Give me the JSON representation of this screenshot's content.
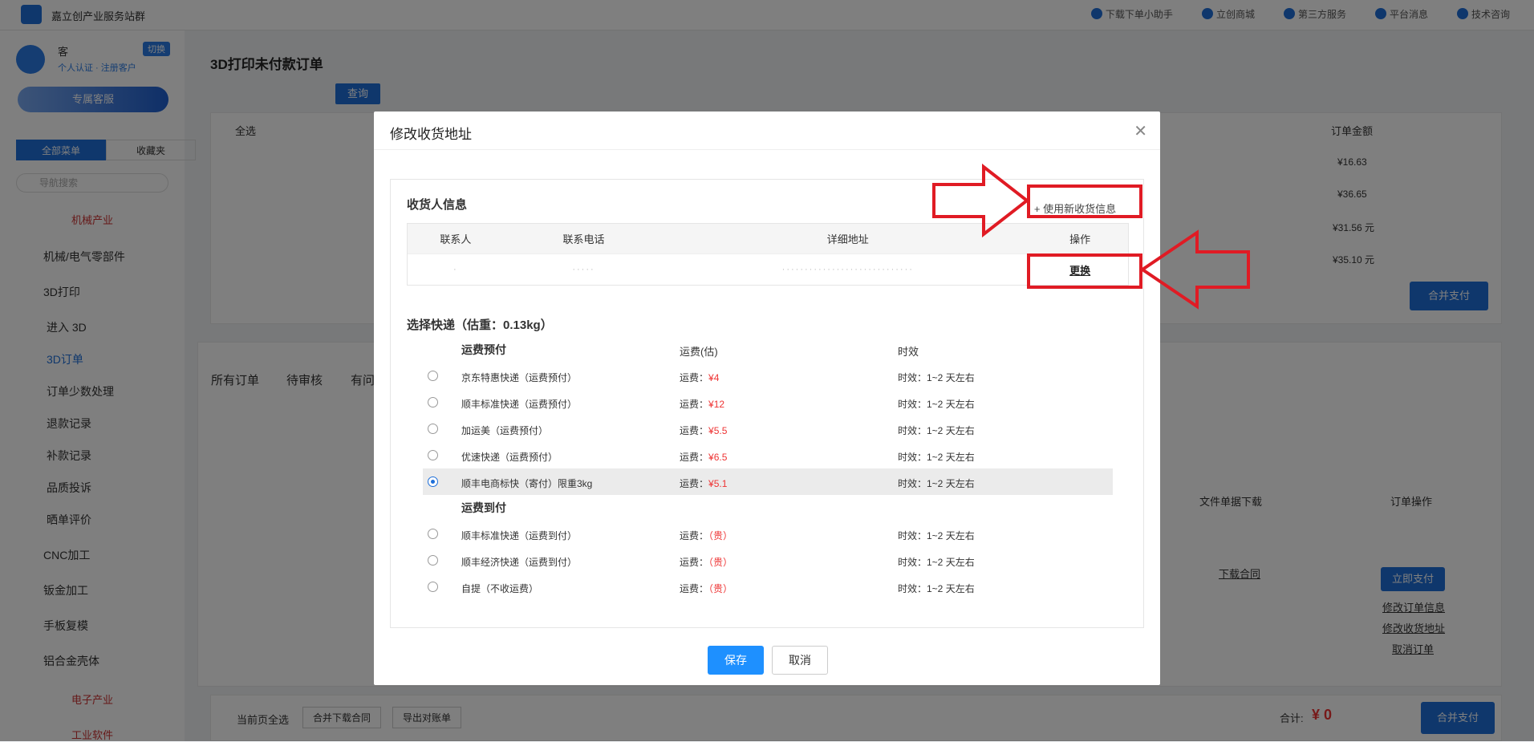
{
  "topbar": {
    "site_name": "嘉立创产业服务站群",
    "links": [
      "下载下单小助手",
      "立创商城",
      "第三方服务",
      "平台消息",
      "技术咨询"
    ]
  },
  "sidebar": {
    "user_badge": "切换",
    "user_sub": "个人认证 · 注册客户",
    "service_button": "专属客服",
    "tab_all": "全部菜单",
    "tab_fav": "收藏夹",
    "search_placeholder": "导航搜索",
    "cat_mech": "机械产业",
    "items": [
      {
        "label": "机械/电气零部件"
      },
      {
        "label": "3D打印"
      },
      {
        "label": "CNC加工"
      },
      {
        "label": "钣金加工"
      },
      {
        "label": "手板复模"
      },
      {
        "label": "铝合金壳体"
      }
    ],
    "subitems": [
      "进入 3D",
      "3D订单",
      "订单少数处理",
      "退款记录",
      "补款记录",
      "品质投诉",
      "晒单评价"
    ],
    "cat_elec": "电子产业",
    "cat_soft": "工业软件"
  },
  "main": {
    "page_title": "3D打印未付款订单",
    "query_btn": "查询",
    "select_all": "全选",
    "order_amount_header": "订单金额",
    "amounts": [
      "¥16.63",
      "¥36.65",
      "¥31.56 元",
      "¥35.10 元"
    ],
    "merge_pay": "合并支付",
    "order_tabs": [
      "所有订单",
      "待审核",
      "有问"
    ],
    "file_dl_header": "文件单据下载",
    "order_op_header": "订单操作",
    "download_contract": "下载合同",
    "pay_now": "立即支付",
    "op_links": [
      "修改订单信息",
      "修改收货地址",
      "取消订单"
    ],
    "footer_select": "当前页全选",
    "footer_merge": "合并下载合同",
    "footer_export": "导出对账单",
    "total_label": "合计:",
    "total_value": "¥ 0"
  },
  "modal": {
    "title": "修改收货地址",
    "recipient_title": "收货人信息",
    "new_address": "+ 使用新收货信息",
    "table_headers": [
      "联系人",
      "联系电话",
      "详细地址",
      "操作"
    ],
    "row": {
      "contact": "·",
      "phone": "·····",
      "address": "·····························",
      "action": "更换"
    },
    "shipping_title": "选择快递（估重：0.13kg）",
    "group_prepaid": "运费预付",
    "col_fee": "运费(估)",
    "col_time": "时效",
    "prepaid_options": [
      {
        "name": "京东特惠快递（运费预付）",
        "fee_label": "运费：",
        "fee": "¥4",
        "time": "时效：1~2 天左右"
      },
      {
        "name": "顺丰标准快递（运费预付）",
        "fee_label": "运费：",
        "fee": "¥12",
        "time": "时效：1~2 天左右"
      },
      {
        "name": "加运美（运费预付）",
        "fee_label": "运费：",
        "fee": "¥5.5",
        "time": "时效：1~2 天左右"
      },
      {
        "name": "优速快递（运费预付）",
        "fee_label": "运费：",
        "fee": "¥6.5",
        "time": "时效：1~2 天左右"
      },
      {
        "name": "顺丰电商标快（寄付）限重3kg",
        "fee_label": "运费：",
        "fee": "¥5.1",
        "time": "时效：1~2 天左右"
      }
    ],
    "group_cod": "运费到付",
    "cod_options": [
      {
        "name": "顺丰标准快递（运费到付）",
        "fee_label": "运费：",
        "fee": "（贵）",
        "time": "时效：1~2 天左右"
      },
      {
        "name": "顺丰经济快递（运费到付）",
        "fee_label": "运费：",
        "fee": "（贵）",
        "time": "时效：1~2 天左右"
      },
      {
        "name": "自提（不收运费）",
        "fee_label": "运费：",
        "fee": "（贵）",
        "time": "时效：1~2 天左右"
      }
    ],
    "save": "保存",
    "cancel": "取消"
  },
  "colors": {
    "primary": "#1e6fd9",
    "annotation_red": "#e01b24",
    "price_red": "#e33"
  }
}
